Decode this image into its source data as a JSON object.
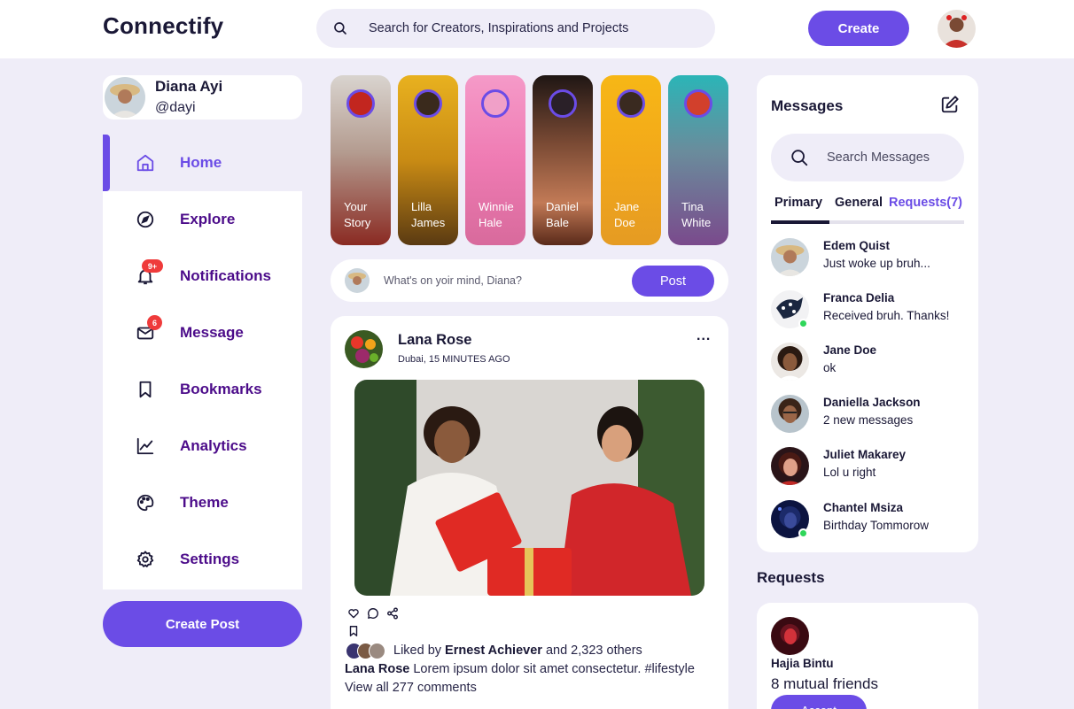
{
  "app": {
    "name": "Connectify"
  },
  "search": {
    "placeholder": "Search for Creators, Inspirations and Projects"
  },
  "header": {
    "create_label": "Create"
  },
  "profile": {
    "name": "Diana Ayi",
    "handle": "@dayi"
  },
  "sidebar": {
    "items": [
      {
        "label": "Home",
        "icon": "home-icon"
      },
      {
        "label": "Explore",
        "icon": "compass-icon"
      },
      {
        "label": "Notifications",
        "icon": "bell-icon",
        "badge": "9+"
      },
      {
        "label": "Message",
        "icon": "mail-icon",
        "badge": "6"
      },
      {
        "label": "Bookmarks",
        "icon": "bookmark-icon"
      },
      {
        "label": "Analytics",
        "icon": "analytics-icon"
      },
      {
        "label": "Theme",
        "icon": "palette-icon"
      },
      {
        "label": "Settings",
        "icon": "gear-icon"
      }
    ],
    "create_post_label": "Create Post"
  },
  "stories": [
    {
      "line1": "Your",
      "line2": "Story"
    },
    {
      "line1": "Lilla",
      "line2": "James"
    },
    {
      "line1": "Winnie",
      "line2": "Hale"
    },
    {
      "line1": "Daniel",
      "line2": "Bale"
    },
    {
      "line1": "Jane",
      "line2": "Doe"
    },
    {
      "line1": "Tina",
      "line2": "White"
    }
  ],
  "compose": {
    "placeholder": "What's on yoir mind, Diana?",
    "post_label": "Post"
  },
  "feed": {
    "author": "Lana Rose",
    "location_time": "Dubai, 15 MINUTES AGO",
    "more": "...",
    "liked_prefix": "Liked by ",
    "liked_name": "Ernest Achiever",
    "liked_suffix": " and 2,323 others",
    "caption_author": "Lana Rose",
    "caption_text": " Lorem ipsum dolor sit amet consectetur. #lifestyle",
    "comments_label": "View all 277 comments"
  },
  "messages": {
    "title": "Messages",
    "search_placeholder": "Search Messages",
    "tabs": [
      "Primary",
      "General",
      "Requests(7)"
    ],
    "conversations": [
      {
        "name": "Edem Quist",
        "message": "Just woke up bruh...",
        "online": false
      },
      {
        "name": "Franca Delia",
        "message": "Received bruh. Thanks!",
        "online": true
      },
      {
        "name": "Jane Doe",
        "message": "ok",
        "online": false
      },
      {
        "name": "Daniella Jackson",
        "message": "2 new messages",
        "online": false
      },
      {
        "name": "Juliet Makarey",
        "message": "Lol u right",
        "online": false
      },
      {
        "name": "Chantel Msiza",
        "message": "Birthday Tommorow",
        "online": true
      }
    ]
  },
  "requests": {
    "title": "Requests",
    "name": "Hajia Bintu",
    "mutual": "8 mutual friends",
    "accept_label": "Accept"
  },
  "colors": {
    "accent": "#6b4ce6",
    "background": "#efedf8",
    "menu_text": "#4c0c8a",
    "badge": "#ef3b3b",
    "online": "#2fd65a"
  }
}
